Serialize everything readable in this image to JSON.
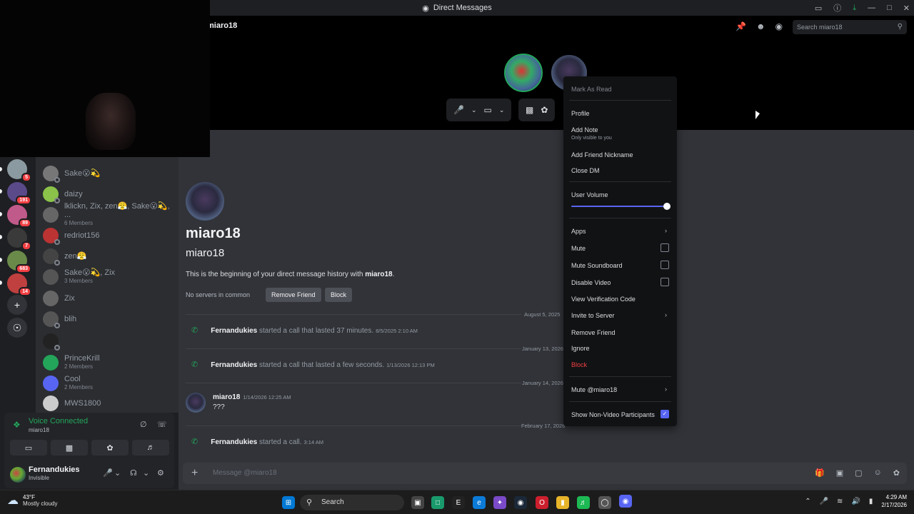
{
  "window": {
    "title": "Direct Messages",
    "icons": [
      "cast-icon",
      "help-icon",
      "download-icon",
      "minimize-icon",
      "maximize-icon",
      "close-icon"
    ]
  },
  "servers": [
    {
      "badge": "5",
      "color": "#8a9aa0"
    },
    {
      "badge": "191",
      "color": "#5a4a8a"
    },
    {
      "badge": "89",
      "color": "#c05a8a"
    },
    {
      "badge": "7",
      "color": "#3a3a3a"
    },
    {
      "badge": "683",
      "color": "#6a8a4a"
    },
    {
      "badge": "14",
      "color": "#c04040"
    }
  ],
  "dm_list": [
    {
      "name": "Sake😮💫",
      "sub": "",
      "color": "#777"
    },
    {
      "name": "daizy",
      "sub": "",
      "color": "#8bc34a"
    },
    {
      "name": "lklickn, Zix, zen😤, Sake😮💫, ...",
      "sub": "6 Members",
      "color": "#666"
    },
    {
      "name": "redriot156",
      "sub": "",
      "color": "#b33"
    },
    {
      "name": "zen😤",
      "sub": "",
      "color": "#444"
    },
    {
      "name": "Sake😮💫, Zix",
      "sub": "3 Members",
      "color": "#555"
    },
    {
      "name": "Zix",
      "sub": "",
      "color": "#666"
    },
    {
      "name": "blih",
      "sub": "",
      "color": "#555"
    },
    {
      "name": "",
      "sub": "",
      "color": "#222"
    },
    {
      "name": "PrinceKrill",
      "sub": "2 Members",
      "color": "#23a55a"
    },
    {
      "name": "Cool",
      "sub": "2 Members",
      "color": "#5865f2"
    },
    {
      "name": "MWS1800",
      "sub": "",
      "color": "#ccc"
    }
  ],
  "voice": {
    "status": "Voice Connected",
    "channel": "miaro18"
  },
  "user": {
    "name": "Fernandukies",
    "status": "Invisible"
  },
  "header": {
    "title": "miaro18",
    "search_placeholder": "Search miaro18"
  },
  "profile": {
    "display_name": "miaro18",
    "username": "miaro18",
    "beginning_text": "This is the beginning of your direct message history with ",
    "beginning_name": "miaro18",
    "beginning_end": ".",
    "no_servers": "No servers in common",
    "remove_friend": "Remove Friend",
    "block": "Block"
  },
  "messages": {
    "day1": "August 5, 2025",
    "call1_name": "Fernandukies",
    "call1_text": " started a call that lasted 37 minutes.",
    "call1_ts": "8/5/2025 2:10 AM",
    "day2": "January 13, 2026",
    "call2_name": "Fernandukies",
    "call2_text": " started a call that lasted a few seconds.",
    "call2_ts": "1/13/2026 12:13 PM",
    "day3": "January 14, 2026",
    "msg_author": "miaro18",
    "msg_ts": "1/14/2026 12:25 AM",
    "msg_text": "???",
    "day4": "February 17, 2026",
    "call3_name": "Fernandukies",
    "call3_text": " started a call.",
    "call3_ts": "3:14 AM"
  },
  "composer": {
    "placeholder": "Message @miaro18"
  },
  "context_menu": {
    "mark_as_read": "Mark As Read",
    "profile": "Profile",
    "add_note": "Add Note",
    "add_note_hint": "Only visible to you",
    "add_friend_nickname": "Add Friend Nickname",
    "close_dm": "Close DM",
    "user_volume": "User Volume",
    "user_volume_value": 1.0,
    "apps": "Apps",
    "mute": "Mute",
    "mute_soundboard": "Mute Soundboard",
    "disable_video": "Disable Video",
    "view_verification_code": "View Verification Code",
    "invite_to_server": "Invite to Server",
    "remove_friend": "Remove Friend",
    "ignore": "Ignore",
    "block": "Block",
    "mute_user": "Mute @miaro18",
    "show_non_video": "Show Non-Video Participants",
    "show_non_video_checked": true
  },
  "taskbar": {
    "temp": "43°F",
    "condition": "Mostly cloudy",
    "search": "Search",
    "time": "4:29 AM",
    "date": "2/17/2026"
  }
}
